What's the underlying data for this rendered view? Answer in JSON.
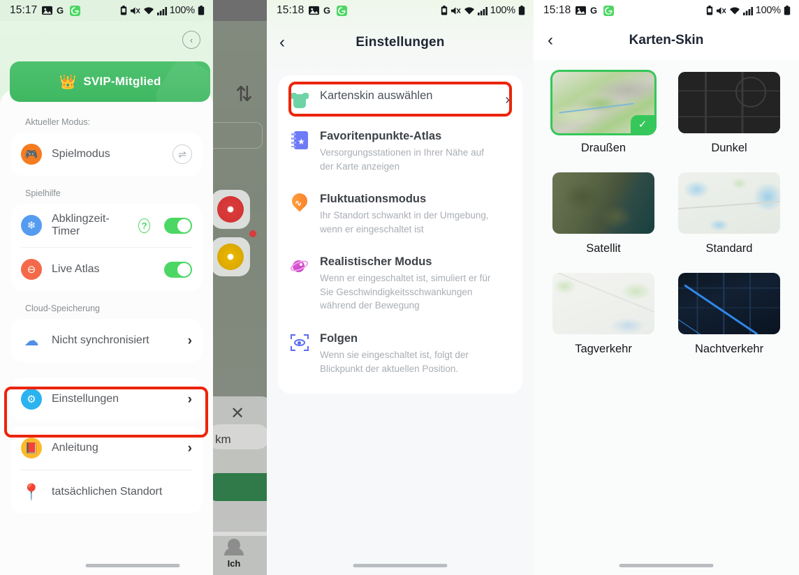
{
  "panels": [
    {
      "status": {
        "time": "15:17",
        "battery": "100%"
      },
      "member_banner": "SVIP-Mitglied",
      "sections": [
        {
          "label": "Aktueller Modus:"
        },
        {
          "label": "Spielhilfe"
        },
        {
          "label": "Cloud-Speicherung"
        }
      ],
      "rows": {
        "game_mode": "Spielmodus",
        "cooldown_timer": "Abklingzeit-Timer",
        "live_atlas": "Live Atlas",
        "not_synced": "Nicht synchronisiert",
        "settings": "Einstellungen",
        "guide": "Anleitung",
        "real_location": "tatsächlichen Standort"
      },
      "background": {
        "distance_unit": "km",
        "tab_label": "Ich"
      }
    },
    {
      "status": {
        "time": "15:18",
        "battery": "100%"
      },
      "title": "Einstellungen",
      "items": [
        {
          "title": "Kartenskin auswählen",
          "sub": "",
          "icon": "shirt-icon",
          "type": "chevron"
        },
        {
          "title": "Favoritenpunkte-Atlas",
          "sub": "Versorgungsstationen in Ihrer Nähe auf der Karte anzeigen",
          "icon": "atlas-book-icon",
          "type": "toggle",
          "on": true
        },
        {
          "title": "Fluktuationsmodus",
          "sub": "Ihr Standort schwankt in der Umgebung, wenn er eingeschaltet ist",
          "icon": "fluctuation-pin-icon",
          "type": "toggle",
          "on": true
        },
        {
          "title": "Realistischer Modus",
          "sub": "Wenn er eingeschaltet ist, simuliert er für Sie Geschwindigkeitsschwankungen während der Bewegung",
          "icon": "planet-icon",
          "type": "toggle",
          "on": true
        },
        {
          "title": "Folgen",
          "sub": "Wenn sie eingeschaltet ist, folgt der Blickpunkt der aktuellen Position.",
          "icon": "eye-focus-icon",
          "type": "toggle",
          "on": true
        }
      ]
    },
    {
      "status": {
        "time": "15:18",
        "battery": "100%"
      },
      "title": "Karten-Skin",
      "skins": [
        {
          "label": "Draußen",
          "selected": true,
          "style": "outdoor"
        },
        {
          "label": "Dunkel",
          "selected": false,
          "style": "dark"
        },
        {
          "label": "Satellit",
          "selected": false,
          "style": "satellite"
        },
        {
          "label": "Standard",
          "selected": false,
          "style": "standard"
        },
        {
          "label": "Tagverkehr",
          "selected": false,
          "style": "day-traffic"
        },
        {
          "label": "Nachtverkehr",
          "selected": false,
          "style": "night-traffic"
        }
      ]
    }
  ],
  "colors": {
    "accent_green": "#4cd764",
    "highlight_red": "#ec2409",
    "brand_green": "#3fb862"
  }
}
